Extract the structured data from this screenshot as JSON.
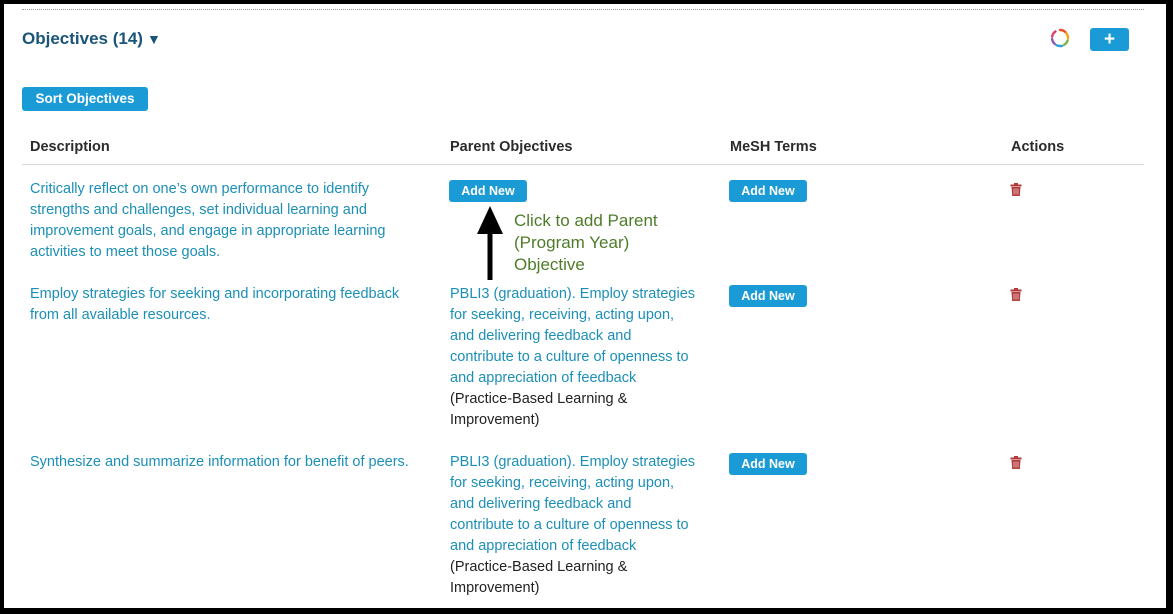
{
  "section": {
    "title": "Objectives (14)",
    "caret": "▼",
    "add_icon": "+",
    "spinner_icon": "loading-spinner-icon"
  },
  "toolbar": {
    "sort_label": "Sort Objectives"
  },
  "table": {
    "columns": [
      "Description",
      "Parent Objectives",
      "MeSH Terms",
      "Actions"
    ],
    "rows": [
      {
        "description": [
          "Critically reflect on one’s own performance to identify",
          "strengths and challenges, set individual learning and",
          "improvement goals, and engage in appropriate learning",
          "activities to meet those goals."
        ],
        "parent_button": "Add New",
        "mesh_button": "Add New",
        "action_icon": "trash-icon"
      },
      {
        "description": [
          "Employ strategies for seeking and incorporating feedback",
          "from all available resources."
        ],
        "parent": [
          "PBLI3 (graduation). Employ strategies",
          "for seeking, receiving, acting upon,",
          "and delivering feedback and",
          "contribute to a culture of openness to",
          "and appreciation of feedback"
        ],
        "parent_domain": [
          "(Practice-Based Learning &",
          "Improvement)"
        ],
        "mesh_button": "Add New",
        "action_icon": "trash-icon"
      },
      {
        "description": [
          "Synthesize and summarize information for benefit of peers."
        ],
        "parent": [
          "PBLI3 (graduation). Employ strategies",
          "for seeking, receiving, acting upon,",
          "and delivering feedback and",
          "contribute to a culture of openness to",
          "and appreciation of feedback"
        ],
        "parent_domain": [
          "(Practice-Based Learning &",
          "Improvement)"
        ],
        "mesh_button": "Add New",
        "action_icon": "trash-icon"
      }
    ]
  },
  "annotation": {
    "text": [
      "Click to add Parent",
      "(Program Year)",
      "Objective"
    ],
    "color": "#4f7c2a"
  },
  "colors": {
    "accent": "#1b9bd6",
    "link": "#1c8fb7",
    "title": "#1a5479",
    "delete": "#b03a3a"
  }
}
